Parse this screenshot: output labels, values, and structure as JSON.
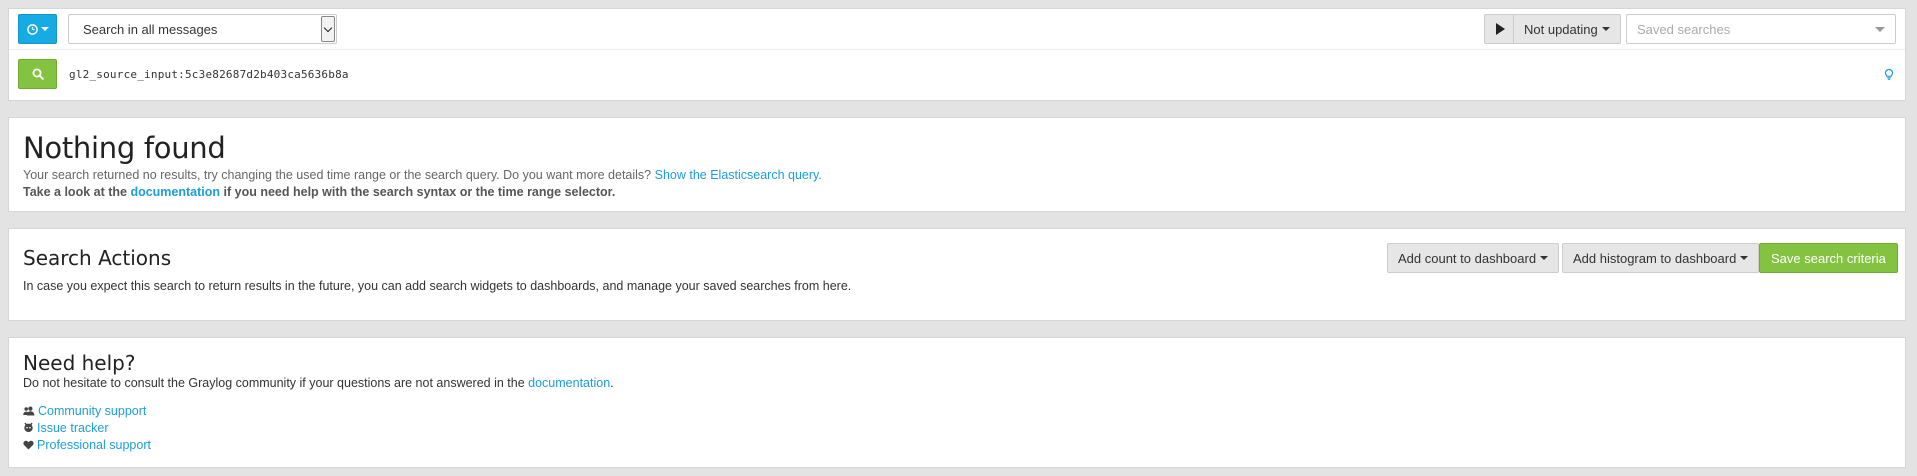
{
  "search_bar": {
    "time_range_button_icon": "clock-icon",
    "range_select_value": "Search in all messages",
    "refresh_label": "Not updating",
    "saved_searches_placeholder": "Saved searches",
    "query": "gl2_source_input:5c3e82687d2b403ca5636b8a",
    "colors": {
      "primary": "#16ace3",
      "success": "#83c341"
    }
  },
  "nothing_found": {
    "title": "Nothing found",
    "text_prefix": "Your search returned no results, try changing the used time range or the search query. Do you want more details?",
    "es_link": "Show the Elasticsearch query.",
    "help_prefix": "Take a look at the",
    "doc_link": "documentation",
    "help_suffix": "if you need help with the search syntax or the time range selector."
  },
  "search_actions": {
    "title": "Search Actions",
    "description": "In case you expect this search to return results in the future, you can add search widgets to dashboards, and manage your saved searches from here.",
    "add_count": "Add count to dashboard",
    "add_histogram": "Add histogram to dashboard",
    "save_criteria": "Save search criteria"
  },
  "need_help": {
    "title": "Need help?",
    "text_prefix": "Do not hesitate to consult the Graylog community if your questions are not answered in the",
    "doc_link": "documentation",
    "text_suffix": ".",
    "links": [
      {
        "icon": "users-icon",
        "label": "Community support"
      },
      {
        "icon": "github-icon",
        "label": "Issue tracker"
      },
      {
        "icon": "heart-icon",
        "label": "Professional support"
      }
    ]
  }
}
